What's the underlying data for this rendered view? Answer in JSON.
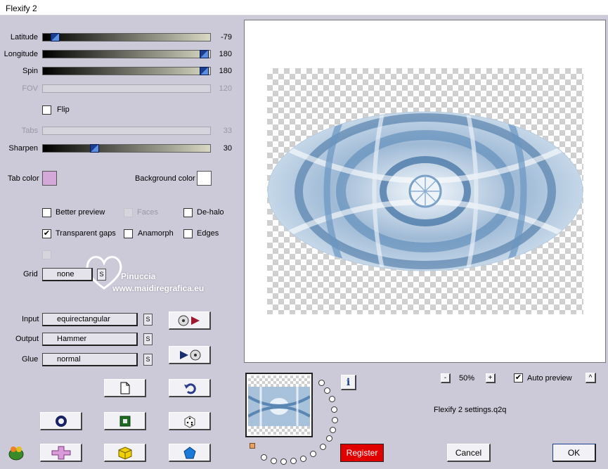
{
  "window": {
    "title": "Flexify 2"
  },
  "sliders": {
    "latitude": {
      "label": "Latitude",
      "value": "-79",
      "fraction": 0.05
    },
    "longitude": {
      "label": "Longitude",
      "value": "180",
      "fraction": 1.0
    },
    "spin": {
      "label": "Spin",
      "value": "180",
      "fraction": 1.0
    },
    "fov": {
      "label": "FOV",
      "value": "120",
      "disabled": true
    },
    "tabs": {
      "label": "Tabs",
      "value": "33",
      "disabled": true
    },
    "sharpen": {
      "label": "Sharpen",
      "value": "30",
      "fraction": 0.3
    }
  },
  "flip": {
    "label": "Flip",
    "checked": false
  },
  "colors": {
    "tab_color_label": "Tab color",
    "tab_color": "#d4a8d8",
    "background_color_label": "Background color",
    "background_color": "#ffffff"
  },
  "options": {
    "better_preview": {
      "label": "Better preview",
      "checked": false
    },
    "faces": {
      "label": "Faces",
      "checked": false,
      "disabled": true
    },
    "de_halo": {
      "label": "De-halo",
      "checked": false
    },
    "transparent_gaps": {
      "label": "Transparent gaps",
      "checked": true
    },
    "anamorph": {
      "label": "Anamorph",
      "checked": false
    },
    "edges": {
      "label": "Edges",
      "checked": false
    }
  },
  "grid": {
    "label": "Grid",
    "value": "none"
  },
  "input": {
    "label": "Input",
    "value": "equirectangular"
  },
  "output": {
    "label": "Output",
    "value": "Hammer"
  },
  "glue": {
    "label": "Glue",
    "value": "normal"
  },
  "s_label": "S",
  "watermark": {
    "name": "Pinuccia",
    "url": "www.maidiregrafica.eu"
  },
  "zoom": {
    "minus": "-",
    "value": "50%",
    "plus": "+"
  },
  "auto_preview": {
    "label": "Auto preview",
    "checked": true
  },
  "up_button": "^",
  "settings_file": "Flexify 2 settings.q2q",
  "register_button": "Register",
  "cancel_button": "Cancel",
  "ok_button": "OK",
  "info_button": "i",
  "colors_theme": {
    "accent": "#1a3d8f",
    "register": "#e00000",
    "panel": "#ccc9d8"
  }
}
